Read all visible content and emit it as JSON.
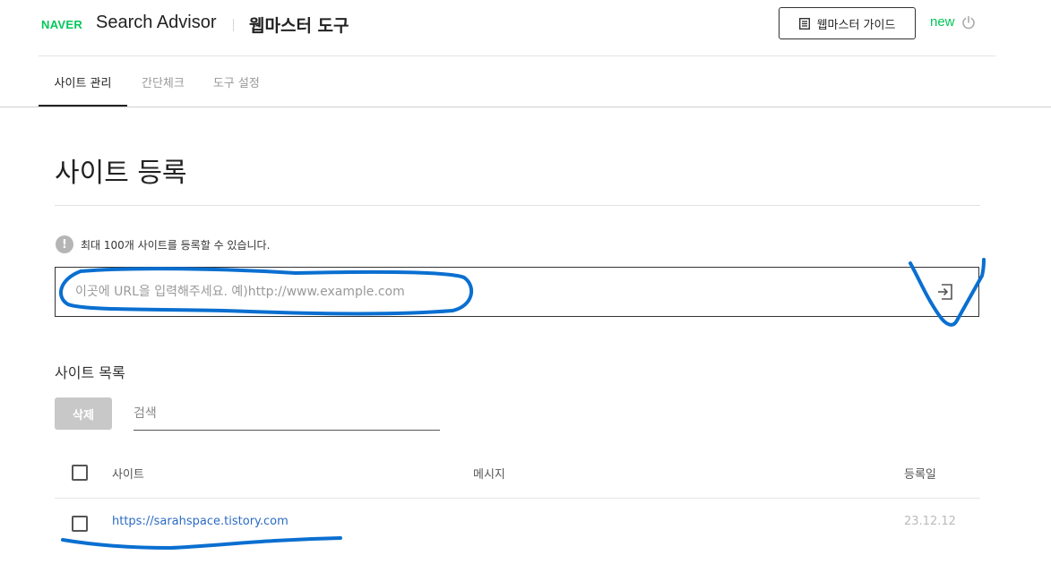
{
  "header": {
    "logo": "NAVER",
    "brand": "Search Advisor",
    "tool_title": "웹마스터 도구",
    "guide_button": "웹마스터 가이드",
    "new_label": "new"
  },
  "tabs": [
    {
      "label": "사이트 관리",
      "active": true
    },
    {
      "label": "간단체크",
      "active": false
    },
    {
      "label": "도구 설정",
      "active": false
    }
  ],
  "main": {
    "title": "사이트 등록",
    "info_text": "최대 100개 사이트를 등록할 수 있습니다.",
    "url_placeholder": "이곳에 URL을 입력해주세요. 예)http://www.example.com"
  },
  "site_list": {
    "title": "사이트 목록",
    "delete_button": "삭제",
    "search_placeholder": "검색",
    "columns": {
      "site": "사이트",
      "message": "메시지",
      "date": "등록일"
    },
    "rows": [
      {
        "site": "https://sarahspace.tistory.com",
        "message": "",
        "date": "23.12.12"
      }
    ]
  },
  "colors": {
    "naver_green": "#03c75a",
    "link_blue": "#2b6bc4",
    "annotation_blue": "#0a6fd0"
  }
}
